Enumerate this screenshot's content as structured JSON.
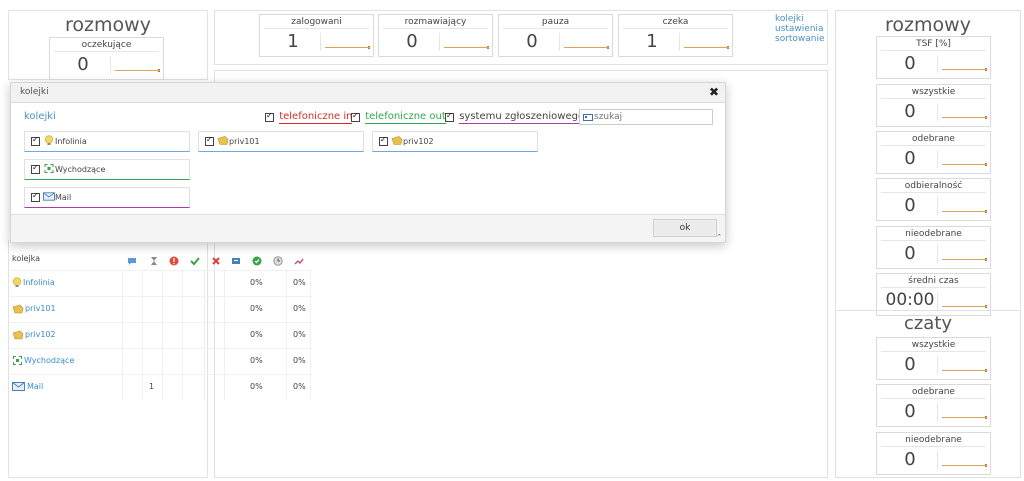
{
  "left_panel": {
    "title": "rozmowy",
    "stat": {
      "label": "oczekujące",
      "value": "0"
    }
  },
  "top_stats": [
    {
      "label": "zalogowani",
      "value": "1"
    },
    {
      "label": "rozmawiający",
      "value": "0"
    },
    {
      "label": "pauza",
      "value": "0"
    },
    {
      "label": "czeka",
      "value": "1"
    }
  ],
  "top_links": [
    "kolejki",
    "ustawienia",
    "sortowanie"
  ],
  "right_panel": {
    "title": "rozmowy",
    "stats": [
      {
        "label": "TSF [%]",
        "value": "0"
      },
      {
        "label": "wszystkie",
        "value": "0"
      },
      {
        "label": "odebrane",
        "value": "0"
      },
      {
        "label": "odbieralność",
        "value": "0"
      },
      {
        "label": "nieodebrane",
        "value": "0"
      },
      {
        "label": "średni czas",
        "value": "00:00"
      }
    ],
    "chats_title": "czaty",
    "chat_stats": [
      {
        "label": "wszystkie",
        "value": "0"
      },
      {
        "label": "odebrane",
        "value": "0"
      },
      {
        "label": "nieodebrane",
        "value": "0"
      }
    ]
  },
  "modal": {
    "title": "kolejki",
    "section_label": "kolejki",
    "filters": [
      {
        "label": "telefoniczne in",
        "color": "#d0312d"
      },
      {
        "label": "telefoniczne out",
        "color": "#2fa84f"
      },
      {
        "label": "systemu zgłoszeniowego",
        "color": "#b03aa8"
      }
    ],
    "search_placeholder": "szukaj",
    "queues": [
      {
        "name": "Infolinia",
        "icon": "bulb-icon",
        "border": "#6fa8dc"
      },
      {
        "name": "priv101",
        "icon": "tag-icon",
        "border": "#6fa8dc"
      },
      {
        "name": "priv102",
        "icon": "tag-icon",
        "border": "#6fa8dc"
      },
      {
        "name": "Wychodzące",
        "icon": "outbound-icon",
        "border": "#2fa84f"
      },
      {
        "name": "Mail",
        "icon": "mail-icon",
        "border": "#b03aa8"
      }
    ],
    "ok_label": "ok"
  },
  "table": {
    "header": "kolejka",
    "rows": [
      {
        "name": "Infolinia",
        "icon": "bulb-icon",
        "waiting": "",
        "pct1": "0%",
        "pct2": "0%"
      },
      {
        "name": "priv101",
        "icon": "tag-icon",
        "waiting": "",
        "pct1": "0%",
        "pct2": "0%"
      },
      {
        "name": "priv102",
        "icon": "tag-icon",
        "waiting": "",
        "pct1": "0%",
        "pct2": "0%"
      },
      {
        "name": "Wychodzące",
        "icon": "outbound-icon",
        "waiting": "",
        "pct1": "0%",
        "pct2": "0%"
      },
      {
        "name": "Mail",
        "icon": "mail-icon",
        "waiting": "1",
        "pct1": "0%",
        "pct2": "0%"
      }
    ]
  },
  "colors": {
    "link": "#4a90c8",
    "accent_line": "#d9a35a"
  }
}
